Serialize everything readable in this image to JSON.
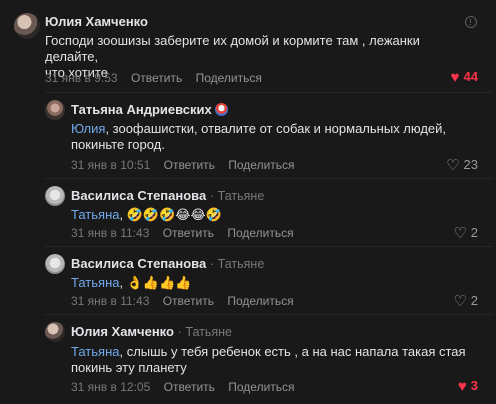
{
  "comments": [
    {
      "author": "Юлия Хамченко",
      "reply_to": "",
      "mention": "",
      "text_line1": "Господи зоошизы заберите их домой и кормите там , лежанки делайте,",
      "text_line2": "что хотите",
      "date": "31 янв в 9:53",
      "reply_label": "Ответить",
      "share_label": "Поделиться",
      "likes": "44",
      "liked": true
    },
    {
      "author": "Татьяна Андриевских",
      "reply_to": "",
      "mention": "Юлия",
      "text_line1": ", зоофашистки, отвалите от собак и нормальных людей,",
      "text_line2": "покиньте город.",
      "date": "31 янв в 10:51",
      "reply_label": "Ответить",
      "share_label": "Поделиться",
      "likes": "23",
      "liked": false
    },
    {
      "author": "Василиса Степанова",
      "reply_to": "Татьяне",
      "mention": "Татьяна",
      "text_line1": ", 🤣🤣🤣😂😂🤣",
      "text_line2": "",
      "date": "31 янв в 11:43",
      "reply_label": "Ответить",
      "share_label": "Поделиться",
      "likes": "2",
      "liked": false
    },
    {
      "author": "Василиса Степанова",
      "reply_to": "Татьяне",
      "mention": "Татьяна",
      "text_line1": ", 👌👍👍👍",
      "text_line2": "",
      "date": "31 янв в 11:43",
      "reply_label": "Ответить",
      "share_label": "Поделиться",
      "likes": "2",
      "liked": false
    },
    {
      "author": "Юлия Хамченко",
      "reply_to": "Татьяне",
      "mention": "Татьяна",
      "text_line1": ", слышь у тебя ребенок есть , а на нас напала такая стая",
      "text_line2": "покинь эту планету",
      "date": "31 янв в 12:05",
      "reply_label": "Ответить",
      "share_label": "Поделиться",
      "likes": "3",
      "liked": true
    }
  ],
  "separator": "·",
  "icons": {
    "heart": "heart-icon",
    "more": "more-info-icon",
    "badge": "profile-badge-icon"
  },
  "colors": {
    "background": "#19191a",
    "text": "#e1e3e6",
    "secondary": "#76787a",
    "mention": "#71aaeb",
    "like_active": "#ff3347"
  }
}
